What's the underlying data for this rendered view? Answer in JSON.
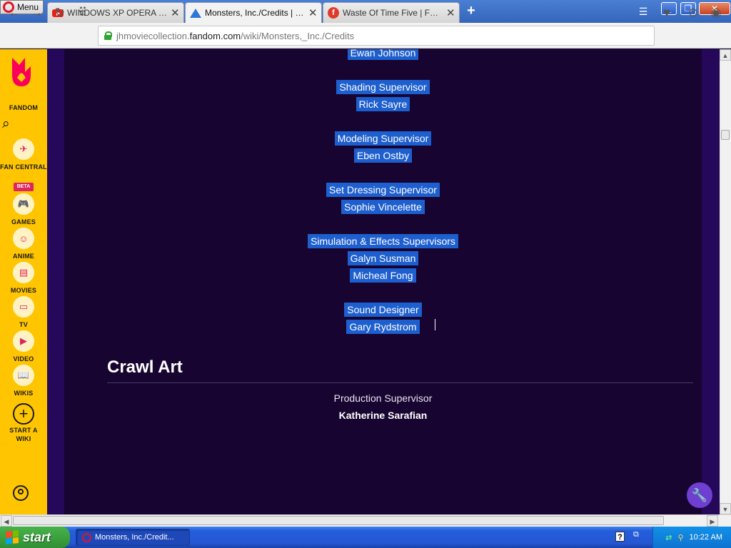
{
  "browser": {
    "menu_label": "Menu",
    "tabs": [
      {
        "label": "WINDOWS XP OPERA - YouT",
        "favicon": "youtube-icon"
      },
      {
        "label": "Monsters, Inc./Credits | JH M",
        "favicon": "fandom-wiki-icon"
      },
      {
        "label": "Waste Of Time Five | Fonts",
        "favicon": "fonts-site-icon"
      }
    ],
    "new_tab": "+",
    "url_prefix": "jhmoviecollection.",
    "url_domain": "fandom.com",
    "url_path": "/wiki/Monsters,_Inc./Credits"
  },
  "sidebar": {
    "brand": "FANDOM",
    "items": [
      {
        "label": "FAN CENTRAL",
        "icon": "rocket-icon",
        "badge": "BETA"
      },
      {
        "label": "GAMES",
        "icon": "gamepad-icon"
      },
      {
        "label": "ANIME",
        "icon": "anime-face-icon"
      },
      {
        "label": "MOVIES",
        "icon": "clapperboard-icon"
      },
      {
        "label": "TV",
        "icon": "tv-icon"
      },
      {
        "label": "VIDEO",
        "icon": "video-play-icon"
      },
      {
        "label": "WIKIS",
        "icon": "book-icon"
      },
      {
        "label": "START A WIKI",
        "icon": "plus-circle-icon"
      }
    ]
  },
  "credits": {
    "selected_lines": [
      "Ewan Johnson",
      "Shading Supervisor",
      "Rick Sayre",
      "Modeling Supervisor",
      "Eben Ostby",
      "Set Dressing Supervisor",
      "Sophie Vincelette",
      "Simulation & Effects Supervisors",
      "Galyn Susman",
      "Micheal Fong",
      "Sound Designer",
      "Gary Rydstrom"
    ],
    "section_title": "Crawl Art",
    "role": "Production Supervisor",
    "person": "Katherine Sarafian"
  },
  "taskbar": {
    "start_label": "start",
    "task_label": "Monsters, Inc./Credit...",
    "clock": "10:22 AM"
  },
  "colors": {
    "fandom_yellow": "#ffc500",
    "page_bg": "#170430",
    "selection": "#1e5fcf",
    "xp_blue": "#245edb"
  }
}
